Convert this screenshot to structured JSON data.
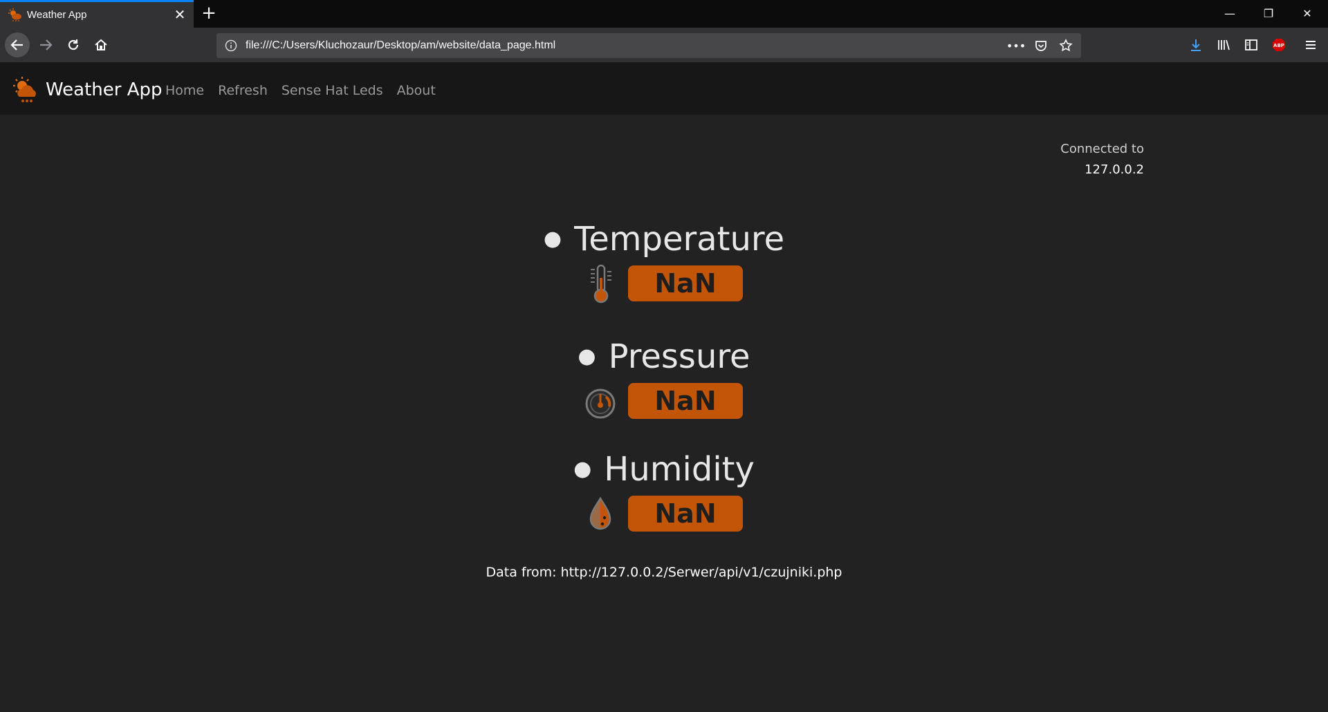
{
  "browser": {
    "tab_title": "Weather App",
    "url": "file:///C:/Users/Kluchozaur/Desktop/am/website/data_page.html",
    "accent_color": "#0a84ff"
  },
  "app": {
    "brand": "Weather App",
    "menu": [
      {
        "label": "Home"
      },
      {
        "label": "Refresh"
      },
      {
        "label": "Sense Hat Leds"
      },
      {
        "label": "About"
      }
    ],
    "connected_label": "Connected to",
    "connected_ip": "127.0.0.2",
    "accent_color": "#c25508"
  },
  "sensors": [
    {
      "title": "Temperature",
      "value": "NaN",
      "icon": "thermometer-icon"
    },
    {
      "title": "Pressure",
      "value": "NaN",
      "icon": "gauge-icon"
    },
    {
      "title": "Humidity",
      "value": "NaN",
      "icon": "water-drop-icon"
    }
  ],
  "footer": {
    "data_from": "Data from: http://127.0.0.2/Serwer/api/v1/czujniki.php"
  }
}
